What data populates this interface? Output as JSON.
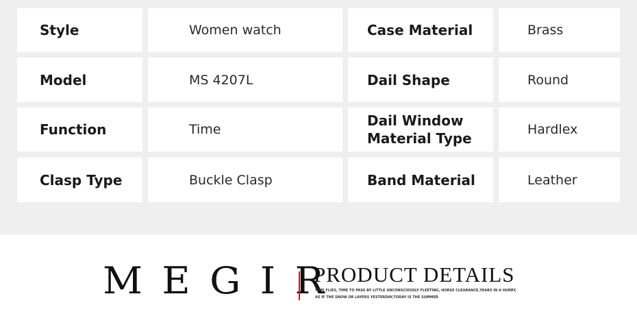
{
  "specs": {
    "rows": [
      {
        "label1": "Style",
        "value1": "Women watch",
        "label2": "Case Material",
        "value2": "Brass"
      },
      {
        "label1": "Model",
        "value1": "MS 4207L",
        "label2": "Dail Shape",
        "value2": "Round"
      },
      {
        "label1": "Function",
        "value1": "Time",
        "label2": "Dail Window Material Type",
        "value2": "Hardlex"
      },
      {
        "label1": "Clasp Type",
        "value1": "Buckle Clasp",
        "label2": "Band Material",
        "value2": "Leather"
      }
    ]
  },
  "brand": {
    "logo": "MEGIR",
    "title": "PRODUCT DETAILS",
    "tagline": "TIME FLIES, TIME TO PASS BY LITTLE UNCONSCIOUSLY FLEETING, HORSE CLEARANCE,YEARS IN A HURRY, AS IF THE SNOW OR LAYERS YESTERDAY,TODAY IS THE SUMMER",
    "accent_color": "#b0202a"
  }
}
